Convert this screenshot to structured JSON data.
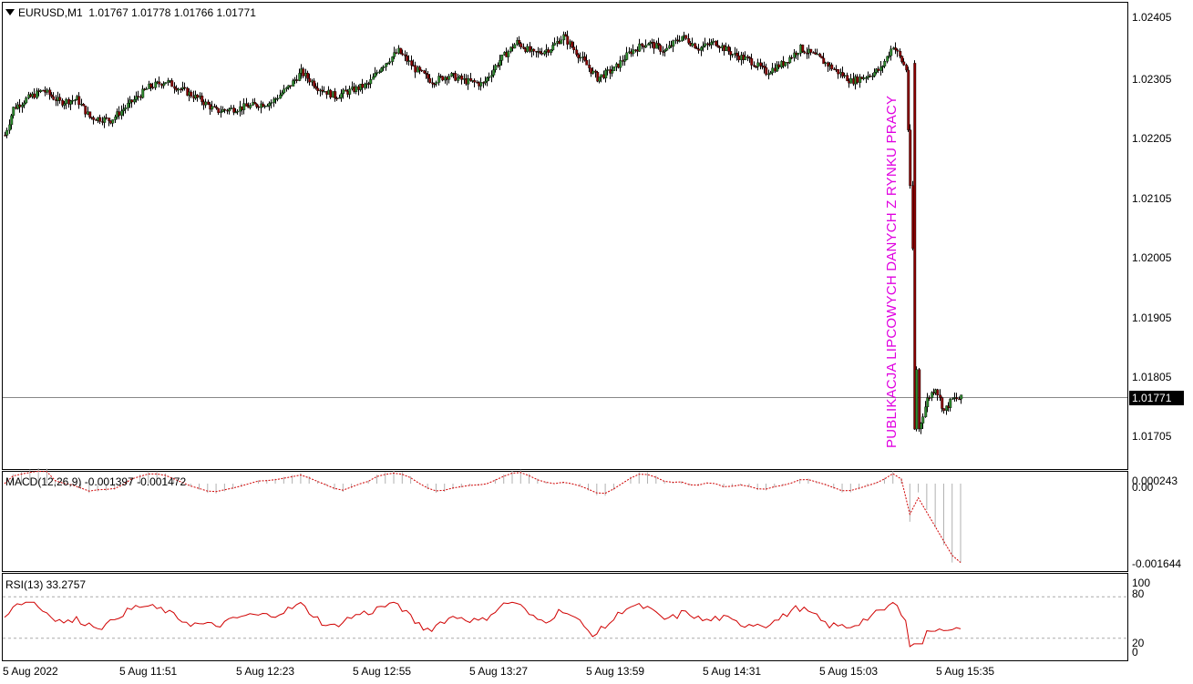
{
  "header": {
    "symbol": "EURUSD,M1",
    "ohlc": "1.01767 1.01778 1.01766 1.01771"
  },
  "price_axis": {
    "labels": [
      "1.02405",
      "1.02305",
      "1.02205",
      "1.02105",
      "1.02005",
      "1.01905",
      "1.01805",
      "1.01705"
    ],
    "current": "1.01771"
  },
  "time_axis": {
    "labels": [
      "5 Aug 2022",
      "5 Aug 11:51",
      "5 Aug 12:23",
      "5 Aug 12:55",
      "5 Aug 13:27",
      "5 Aug 13:59",
      "5 Aug 14:31",
      "5 Aug 15:03",
      "5 Aug 15:35"
    ]
  },
  "annotation": {
    "text": "PUBLIKACJA LIPCOWYCH DANYCH Z RYNKU PRACY",
    "color": "#e000e0"
  },
  "macd": {
    "title": "MACD(12,26,9) -0.001397 -0.001472",
    "labels": [
      "0.000243",
      "0.00",
      "-0.001644"
    ]
  },
  "rsi": {
    "title": "RSI(13) 33.2757",
    "labels": [
      "100",
      "80",
      "20",
      "0"
    ]
  },
  "colors": {
    "bull": "#2e8b2e",
    "bear": "#8b0000",
    "signal": "#d00000",
    "histogram": "#b0b0b0"
  },
  "chart_data": {
    "type": "candlestick",
    "symbol": "EURUSD",
    "timeframe": "M1",
    "ylim": [
      1.01665,
      1.02425
    ],
    "current_price": 1.01771,
    "key_levels": {
      "pre_release_range": [
        1.0227,
        1.024
      ],
      "release_drop_low": 1.0168,
      "post_release_high": 1.0185
    },
    "x_ticks": [
      "5 Aug 2022",
      "5 Aug 11:51",
      "5 Aug 12:23",
      "5 Aug 12:55",
      "5 Aug 13:27",
      "5 Aug 13:59",
      "5 Aug 14:31",
      "5 Aug 15:03",
      "5 Aug 15:35"
    ],
    "macd": {
      "params": "12,26,9",
      "main": -0.001397,
      "signal": -0.001472,
      "ylim": [
        -0.001644,
        0.000243
      ]
    },
    "rsi": {
      "period": 13,
      "value": 33.2757,
      "levels": [
        20,
        80
      ],
      "ylim": [
        0,
        100
      ]
    }
  }
}
